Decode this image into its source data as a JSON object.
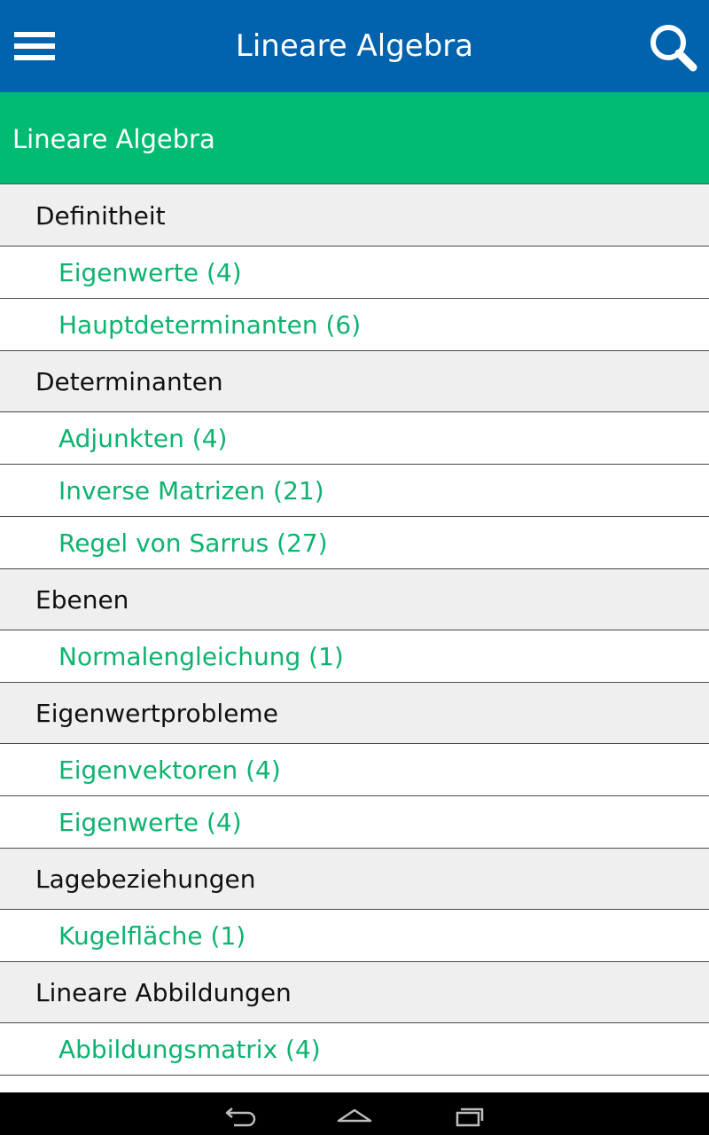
{
  "header": {
    "title": "Lineare Algebra"
  },
  "section": {
    "title": "Lineare Algebra"
  },
  "list": [
    {
      "type": "category",
      "label": "Definitheit"
    },
    {
      "type": "topic",
      "label": "Eigenwerte (4)"
    },
    {
      "type": "topic",
      "label": "Hauptdeterminanten (6)"
    },
    {
      "type": "category",
      "label": "Determinanten"
    },
    {
      "type": "topic",
      "label": "Adjunkten (4)"
    },
    {
      "type": "topic",
      "label": "Inverse Matrizen (21)"
    },
    {
      "type": "topic",
      "label": "Regel von Sarrus (27)"
    },
    {
      "type": "category",
      "label": "Ebenen"
    },
    {
      "type": "topic",
      "label": "Normalengleichung (1)"
    },
    {
      "type": "category",
      "label": "Eigenwertprobleme"
    },
    {
      "type": "topic",
      "label": "Eigenvektoren (4)"
    },
    {
      "type": "topic",
      "label": "Eigenwerte (4)"
    },
    {
      "type": "category",
      "label": "Lagebeziehungen"
    },
    {
      "type": "topic",
      "label": "Kugelfläche (1)"
    },
    {
      "type": "category",
      "label": "Lineare Abbildungen"
    },
    {
      "type": "topic",
      "label": "Abbildungsmatrix (4)"
    }
  ],
  "icons": {
    "menu": "hamburger-menu-icon",
    "search": "search-icon",
    "back": "back-icon",
    "home": "home-icon",
    "recents": "recents-icon"
  },
  "colors": {
    "toolbar": "#0163ad",
    "section": "#00bb71",
    "topic_text": "#0db36f",
    "category_bg": "#efefef"
  }
}
